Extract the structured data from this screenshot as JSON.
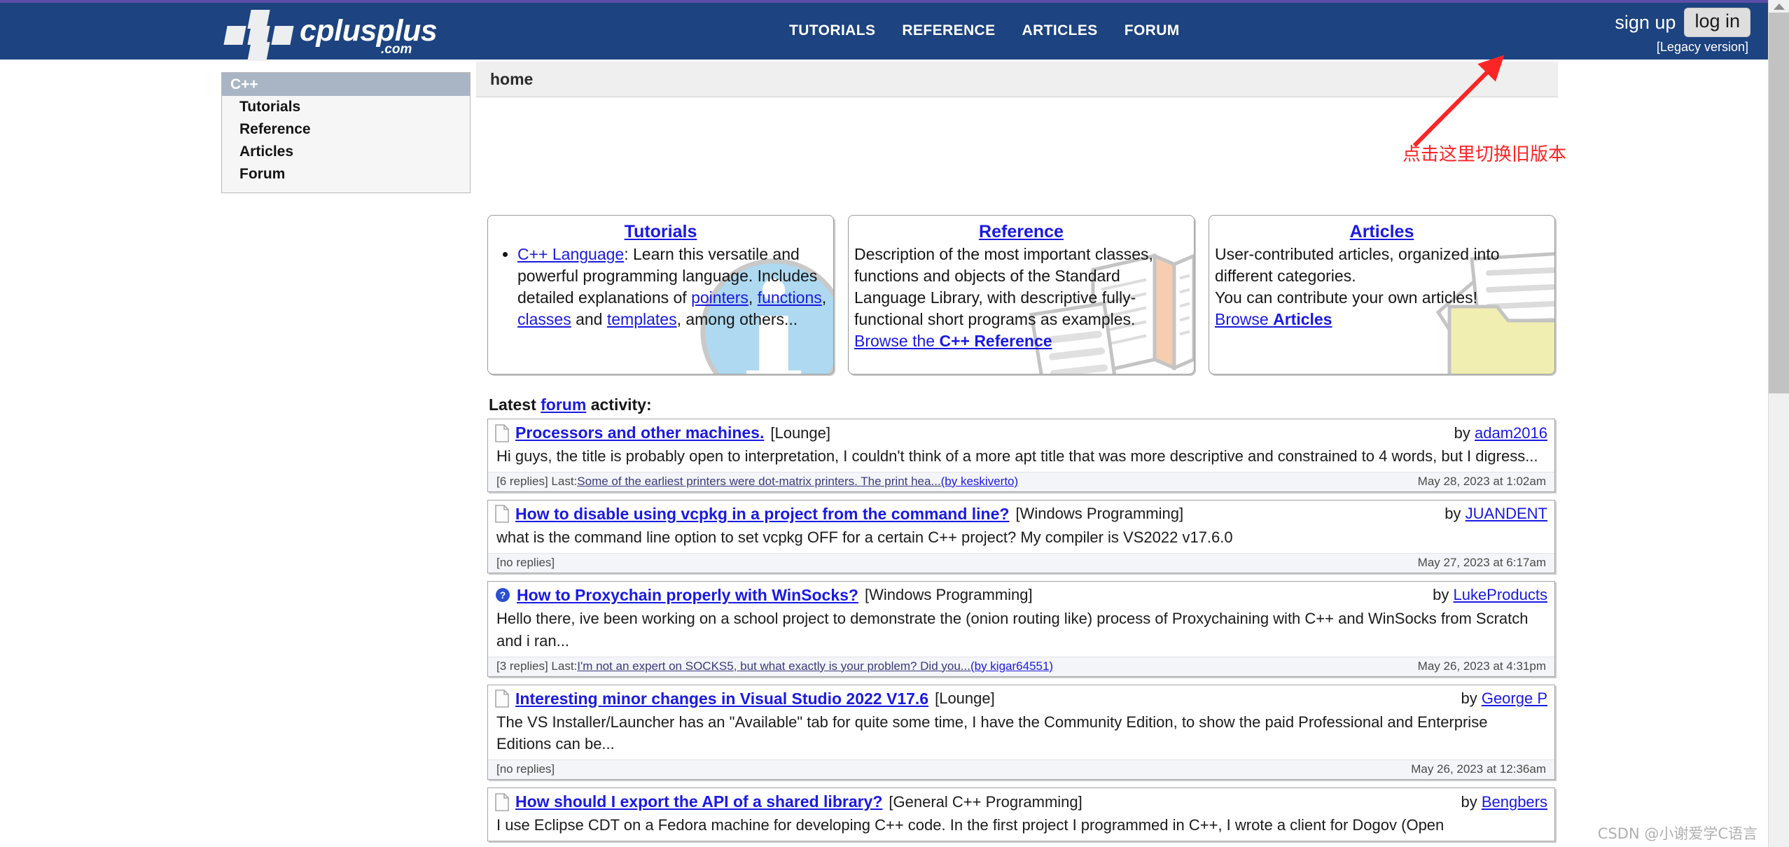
{
  "site": {
    "logo_text": "cplusplus",
    "logo_suffix": ".com"
  },
  "header": {
    "nav": [
      {
        "label": "TUTORIALS"
      },
      {
        "label": "REFERENCE"
      },
      {
        "label": "ARTICLES"
      },
      {
        "label": "FORUM"
      }
    ],
    "sign_up": "sign up",
    "log_in": "log in",
    "legacy": "[Legacy version]"
  },
  "breadcrumb": {
    "current": "home"
  },
  "sidebar": {
    "title": "C++",
    "items": [
      {
        "label": "Tutorials"
      },
      {
        "label": "Reference"
      },
      {
        "label": "Articles"
      },
      {
        "label": "Forum"
      }
    ]
  },
  "annotation": {
    "text": "点击这里切换旧版本",
    "color": "#fb2525"
  },
  "feature_boxes": {
    "tutorials": {
      "title": "Tutorials",
      "link_lang": "C++ Language",
      "body_1": ": Learn this versatile and powerful programming language. Includes detailed explanations of ",
      "link_pointers": "pointers",
      "sep_1": ", ",
      "link_functions": "functions",
      "sep_2": ", ",
      "link_classes": "classes",
      "sep_3": " and ",
      "link_templates": "templates",
      "body_2": ", among others..."
    },
    "reference": {
      "title": "Reference",
      "body": "Description of the most important classes, functions and objects of the Standard Language Library, with descriptive fully-functional short programs as examples.",
      "browse_prefix": "Browse the ",
      "browse_bold": "C++ Reference"
    },
    "articles": {
      "title": "Articles",
      "body_1": "User-contributed articles, organized into different categories.",
      "body_2": "You can contribute your own articles!",
      "browse_prefix": "Browse ",
      "browse_bold": "Articles"
    }
  },
  "latest_activity": {
    "prefix": "Latest ",
    "link": "forum",
    "suffix": " activity:"
  },
  "threads": [
    {
      "icon": "document-icon",
      "title": "Processors and other machines.",
      "category": "[Lounge]",
      "by_prefix": "by ",
      "author": "adam2016",
      "excerpt": "Hi guys, the title is probably open to interpretation, I couldn't think of a more apt title that was more descriptive and constrained to 4 words, but I digress...",
      "replies": "[6 replies] Last: ",
      "last_post": "Some of the earliest printers were dot-matrix printers. The print hea...",
      "last_author": " (by keskiverto)",
      "date": "May 28, 2023 at 1:02am"
    },
    {
      "icon": "document-icon",
      "title": "How to disable using vcpkg in a project from the command line?",
      "category": "[Windows Programming]",
      "by_prefix": "by ",
      "author": "JUANDENT",
      "excerpt": "what is the command line option to set vcpkg OFF for a certain C++ project? My compiler is VS2022 v17.6.0",
      "replies": "[no replies]",
      "last_post": "",
      "last_author": "",
      "date": "May 27, 2023 at 6:17am"
    },
    {
      "icon": "question-icon",
      "title": "How to Proxychain properly with WinSocks?",
      "category": "[Windows Programming]",
      "by_prefix": "by ",
      "author": "LukeProducts",
      "excerpt": "Hello there, ive been working on a school project to demonstrate the (onion routing like) process of Proxychaining with C++ and WinSocks from Scratch and i ran...",
      "replies": "[3 replies] Last: ",
      "last_post": "I'm not an expert on SOCKS5, but what exactly is your problem? Did you...",
      "last_author": " (by kigar64551)",
      "date": "May 26, 2023 at 4:31pm"
    },
    {
      "icon": "document-icon",
      "title": "Interesting minor changes in Visual Studio 2022 V17.6",
      "category": "[Lounge]",
      "by_prefix": "by ",
      "author": "George P",
      "excerpt": "The VS Installer/Launcher has an \"Available\" tab for quite some time, I have the Community Edition, to show the paid Professional and Enterprise Editions can be...",
      "replies": "[no replies]",
      "last_post": "",
      "last_author": "",
      "date": "May 26, 2023 at 12:36am"
    },
    {
      "icon": "document-icon",
      "title": "How should I export the API of a shared library?",
      "category": "[General C++ Programming]",
      "by_prefix": "by ",
      "author": "Bengbers",
      "excerpt": "I use Eclipse CDT on a Fedora machine for developing C++ code. In the first project I programmed in C++, I wrote a client for Dogov (Open",
      "replies": "",
      "last_post": "",
      "last_author": "",
      "date": ""
    }
  ],
  "watermark": {
    "text": "CSDN @小谢爱学C语言"
  }
}
